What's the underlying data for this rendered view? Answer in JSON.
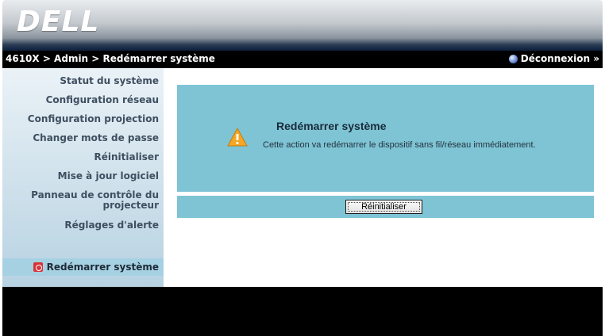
{
  "brand": {
    "logo_text": "DELL"
  },
  "topbar": {
    "breadcrumb": "4610X > Admin > Redémarrer système",
    "logout_label": "Déconnexion »"
  },
  "sidebar": {
    "items": [
      {
        "label": "Statut du système"
      },
      {
        "label": "Configuration réseau"
      },
      {
        "label": "Configuration projection"
      },
      {
        "label": "Changer mots de passe"
      },
      {
        "label": "Réinitialiser"
      },
      {
        "label": "Mise à jour logiciel"
      },
      {
        "label_line1": "Panneau de contrôle du",
        "label_line2": "projecteur"
      },
      {
        "label": "Réglages d'alerte"
      }
    ],
    "active": {
      "label": "Redémarrer système",
      "icon": "power-icon"
    }
  },
  "main": {
    "title": "Redémarrer système",
    "message": "Cette action va redémarrer le dispositif sans fil/réseau immédiatement.",
    "icon": "warning-icon",
    "button_label": "Réinitialiser"
  },
  "colors": {
    "panel": "#7ec4d4",
    "active_nav": "#a6d1e3",
    "topbar": "#000000",
    "warning": "#f5a623"
  }
}
